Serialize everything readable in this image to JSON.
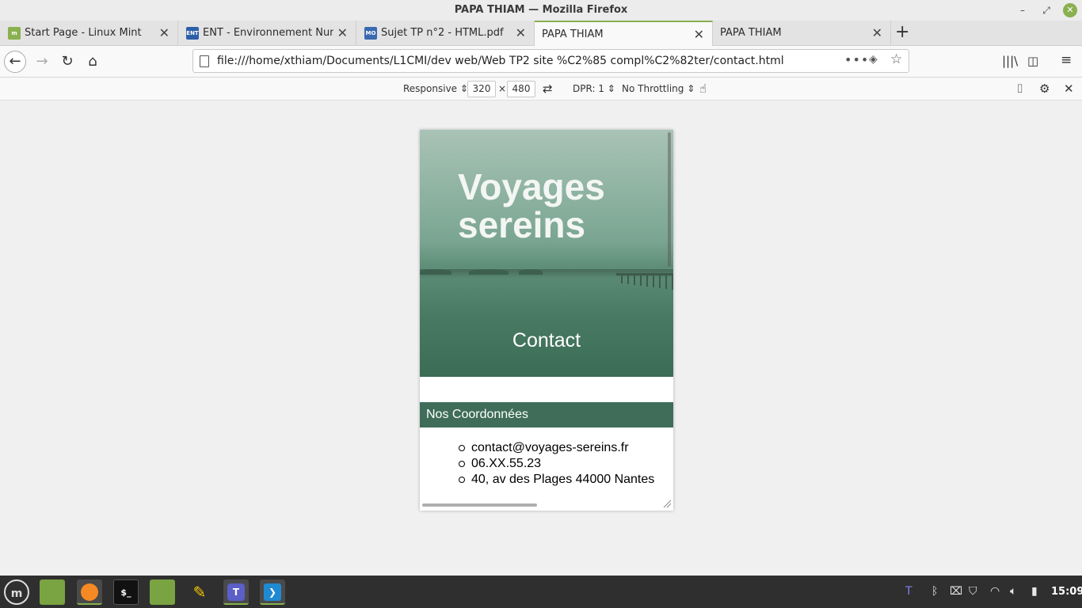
{
  "window": {
    "title": "PAPA THIAM — Mozilla Firefox"
  },
  "tabs": [
    {
      "label": "Start Page - Linux Mint",
      "favicon": "linux-mint-icon"
    },
    {
      "label": "ENT - Environnement Numé",
      "favicon": "ENT"
    },
    {
      "label": "Sujet TP n°2 - HTML.pdf",
      "favicon": "M OO"
    },
    {
      "label": "PAPA THIAM",
      "active": true
    },
    {
      "label": "PAPA THIAM"
    }
  ],
  "navbar": {
    "url": "file:///home/xthiam/Documents/L1CMI/dev web/Web TP2 site %C2%85 compl%C2%82ter/contact.html"
  },
  "rdm": {
    "device": "Responsive ⇕",
    "width": "320",
    "times": "×",
    "height": "480",
    "dpr": "DPR: 1 ⇕",
    "throttling": "No Throttling ⇕"
  },
  "page": {
    "title": "Voyages sereins",
    "subtitle": "Contact",
    "section_heading": "Nos Coordonnées",
    "contacts": [
      "contact@voyages-sereins.fr",
      "06.XX.55.23",
      "40, av des Plages 44000 Nantes"
    ]
  },
  "taskbar": {
    "clock": "15:09"
  },
  "colors": {
    "accent": "#8ab04f",
    "section_bg": "#3f6d5a",
    "taskbar_bg": "#2f2f2f"
  }
}
